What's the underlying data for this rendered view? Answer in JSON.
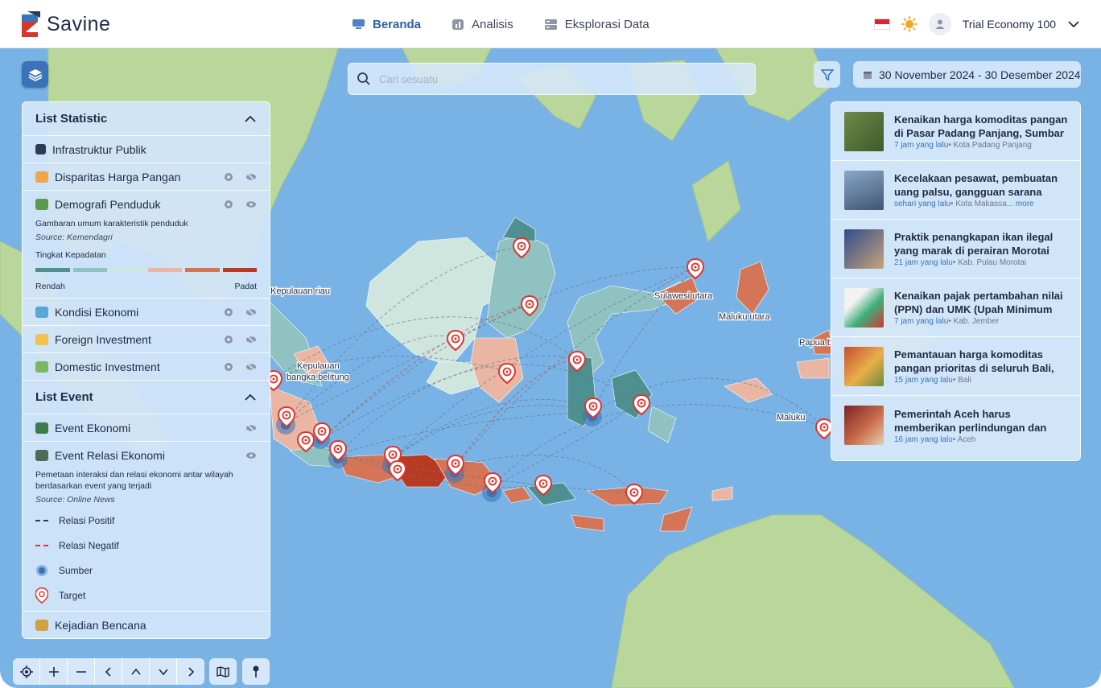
{
  "app": {
    "brand": "Savine"
  },
  "nav": {
    "items": [
      {
        "label": "Beranda",
        "icon": "monitor-icon",
        "active": true
      },
      {
        "label": "Analisis",
        "icon": "chart-icon",
        "active": false
      },
      {
        "label": "Eksplorasi Data",
        "icon": "database-icon",
        "active": false
      }
    ]
  },
  "user": {
    "name": "Trial Economy 100",
    "language_flag": "indonesia-flag-icon",
    "theme_icon": "sun-icon"
  },
  "search": {
    "placeholder": "Cari sesuatu",
    "value": ""
  },
  "date_range": {
    "label": "30 November 2024 - 30 Desember 2024"
  },
  "list_statistic": {
    "title": "List Statistic",
    "items": [
      {
        "label": "Infrastruktur Publik",
        "visible": null
      },
      {
        "label": "Disparitas Harga Pangan",
        "visible": false
      },
      {
        "label": "Demografi Penduduk",
        "visible": true
      },
      {
        "label": "Kondisi Ekonomi",
        "visible": false
      },
      {
        "label": "Foreign Investment",
        "visible": false
      },
      {
        "label": "Domestic Investment",
        "visible": false
      }
    ],
    "demografi_detail": {
      "description": "Gambaran umum karakteristik penduduk",
      "source": "Source: Kemendagri",
      "scale_title": "Tingkat Kepadatan",
      "scale_colors": [
        "#4e8f90",
        "#8fc2c0",
        "#cfe6df",
        "#eab6a3",
        "#d57558",
        "#b83a22"
      ],
      "low_label": "Rendah",
      "high_label": "Padat"
    }
  },
  "list_event": {
    "title": "List Event",
    "items": [
      {
        "label": "Event Ekonomi",
        "visible": false
      },
      {
        "label": "Event Relasi Ekonomi",
        "visible": true
      }
    ],
    "relasi_detail": {
      "description": "Pemetaan interaksi dan relasi ekonomi antar wilayah berdasarkan event yang terjadi",
      "source": "Source: Online News",
      "legend": [
        {
          "label": "Relasi Positif",
          "color": "#2d3b55"
        },
        {
          "label": "Relasi Negatif",
          "color": "#d7362a"
        },
        {
          "label": "Sumber",
          "color": "#3a73b8"
        },
        {
          "label": "Target",
          "color": "#e0332c"
        }
      ]
    },
    "last_item": {
      "label": "Kejadian Bencana"
    }
  },
  "map_labels": {
    "kepulauan_riau": "Kepulauan riau",
    "kepulauan_babel_1": "Kepulauan",
    "kepulauan_babel_2": "bangka belitung",
    "sulawesi_utara": "Sulawesi utara",
    "maluku_utara": "Maluku utara",
    "papua_barat": "Papua b",
    "maluku": "Maluku"
  },
  "news": [
    {
      "title": "Kenaikan harga komoditas pangan di Pasar Padang Panjang, Sumbar",
      "time": "7 jam yang lalu",
      "location": "Kota Padang Panjang",
      "more": "",
      "thumb_color": "#5c7a3a"
    },
    {
      "title": "Kecelakaan pesawat, pembuatan uang palsu, gangguan sarana kereta",
      "time": "sehari yang lalu",
      "location": "Kota Makassa...",
      "more": "more",
      "thumb_color": "#4c6b8e"
    },
    {
      "title": "Praktik penangkapan ikan ilegal yang marak di perairan Morotai telah",
      "time": "21 jam yang lalu",
      "location": "Kab. Pulau Morotai",
      "more": "",
      "thumb_color": "#2e4d8c"
    },
    {
      "title": "Kenaikan pajak pertambahan nilai (PPN) dan UMK (Upah Minimum Kabupaten)",
      "time": "7 jam yang lalu",
      "location": "Kab. Jember",
      "more": "",
      "thumb_color": "#3fae7c"
    },
    {
      "title": "Pemantauan harga komoditas pangan prioritas di seluruh Bali, termasuk",
      "time": "15 jam yang lalu",
      "location": "Bali",
      "more": "",
      "thumb_color": "#b0533a"
    },
    {
      "title": "Pemerintah Aceh harus memberikan perlindungan dan kebijakan khusus bagi",
      "time": "16 jam yang lalu",
      "location": "Aceh",
      "more": "",
      "thumb_color": "#8a2c2c"
    }
  ],
  "colors": {
    "accent": "#3a73b8",
    "sea": "#79b3e6",
    "panel": "#d2e5fa"
  }
}
